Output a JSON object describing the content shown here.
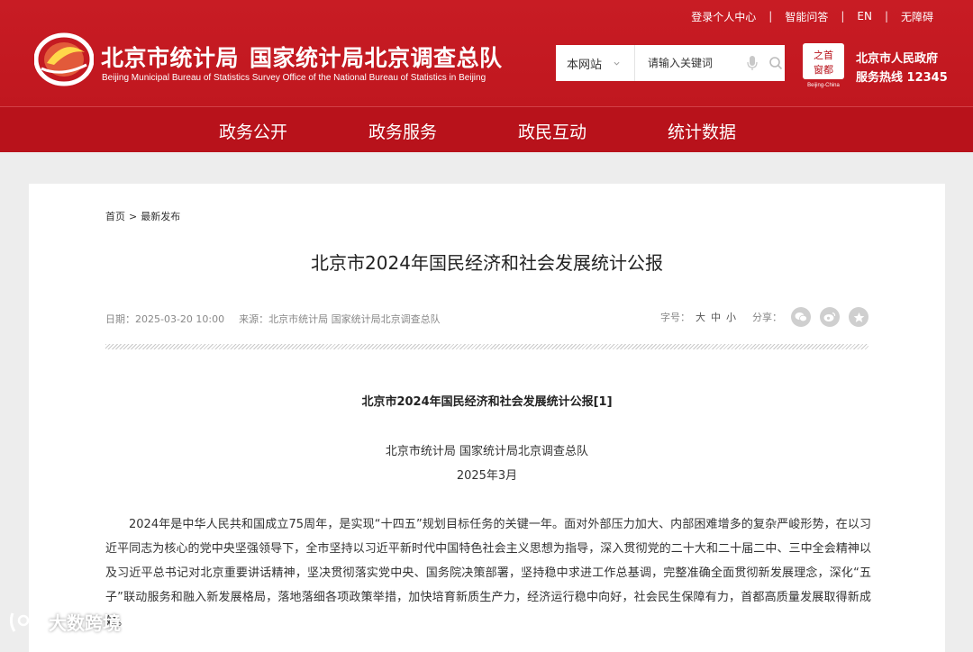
{
  "topnav": {
    "login": "登录个人中心",
    "qa": "智能问答",
    "en": "EN",
    "accessibility": "无障碍"
  },
  "site": {
    "title_a": "北京市统计局",
    "title_b": "国家统计局北京调查总队",
    "subtitle": "Beijing Municipal Bureau of Statistics  Survey Office of the National Bureau of Statistics in Beijing"
  },
  "search": {
    "scope": "本网站",
    "placeholder": "请输入关键词"
  },
  "gov": {
    "name": "北京市人民政府",
    "hotline": "服务热线 12345",
    "emblem_caption": "Beijing-China"
  },
  "mainnav": {
    "items": [
      "政务公开",
      "政务服务",
      "政民互动",
      "统计数据"
    ]
  },
  "breadcrumb": {
    "home": "首页",
    "separator": ">",
    "current": "最新发布"
  },
  "article": {
    "title": "北京市2024年国民经济和社会发展统计公报",
    "date_label": "日期：",
    "date": "2025-03-20 10:00",
    "source_label": "来源：",
    "source": "北京市统计局 国家统计局北京调查总队",
    "font_label": "字号：",
    "font_sizes": [
      "大",
      "中",
      "小"
    ],
    "share_label": "分享：",
    "body_title": "北京市2024年国民经济和社会发展统计公报[1]",
    "body_org": "北京市统计局 国家统计局北京调查总队",
    "body_date": "2025年3月",
    "paragraph": "2024年是中华人民共和国成立75周年，是实现“十四五”规划目标任务的关键一年。面对外部压力加大、内部困难增多的复杂严峻形势，在以习近平同志为核心的党中央坚强领导下，全市坚持以习近平新时代中国特色社会主义思想为指导，深入贯彻党的二十大和二十届二中、三中全会精神以及习近平总书记对北京重要讲话精神，坚决贯彻落实党中央、国务院决策部署，坚持稳中求进工作总基调，完整准确全面贯彻新发展理念，深化“五子”联动服务和融入新发展格局，落地落细各项政策举措，加快培育新质生产力，经济运行稳中向好，社会民生保障有力，首都高质量发展取得新成效。"
  },
  "watermark": {
    "text": "大数跨境"
  },
  "colors": {
    "brand_red": "#c61a22",
    "nav_red": "#b8121b",
    "page_bg": "#ededed"
  },
  "icons": [
    "emblem-logo-icon",
    "chevron-down-icon",
    "mic-icon",
    "search-icon",
    "gov-seal-icon",
    "wechat-icon",
    "weibo-icon",
    "favorite-icon",
    "watermark-logo-icon"
  ]
}
